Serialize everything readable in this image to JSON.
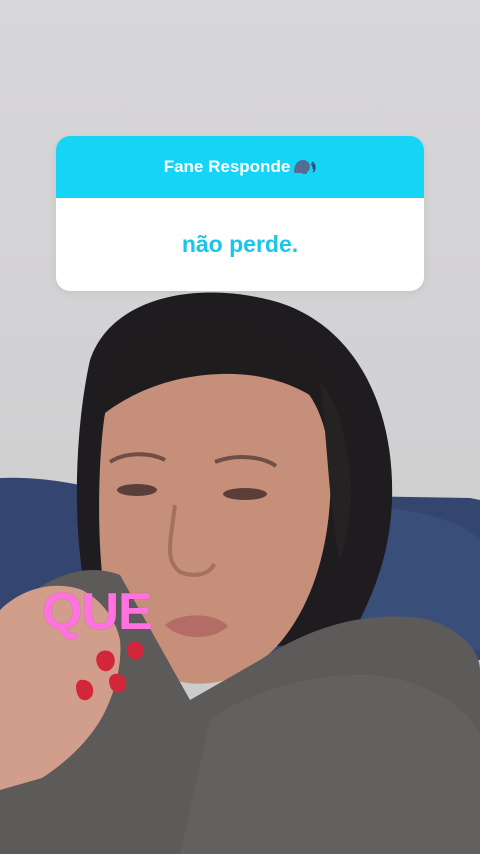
{
  "question_box": {
    "header": "Fane Responde",
    "header_icon": "speaking-head-icon",
    "body": "não perde."
  },
  "caption": {
    "text": "QUE",
    "color": "#ff72e0"
  },
  "colors": {
    "card_header": "#16d4f5",
    "card_body_text": "#18c6e8",
    "card_background": "#ffffff"
  }
}
